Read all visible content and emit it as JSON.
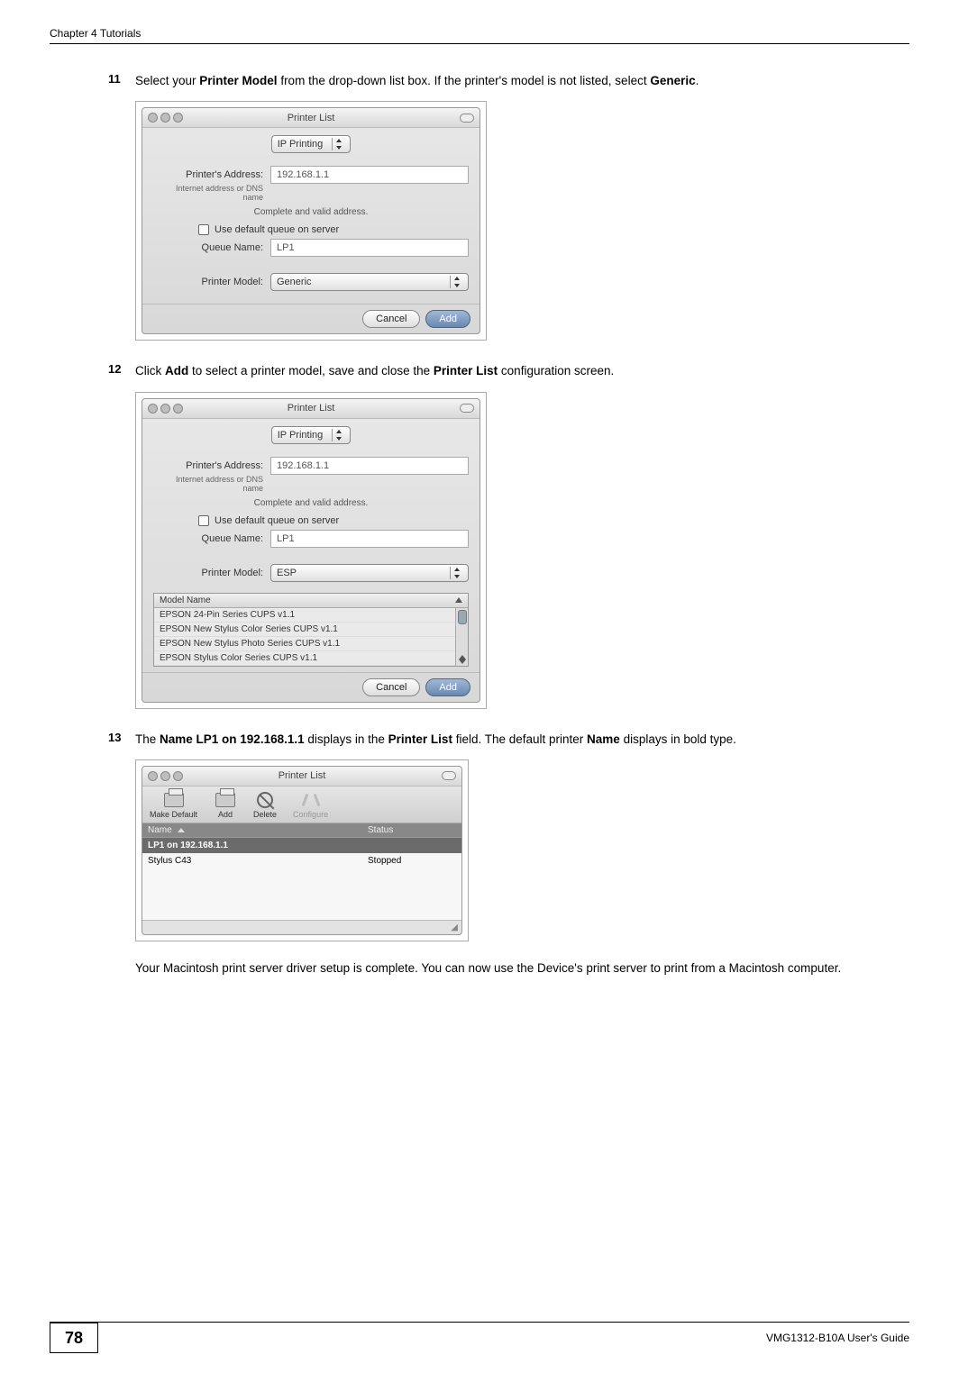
{
  "header": {
    "left": "Chapter 4 Tutorials"
  },
  "steps": {
    "s11": {
      "num": "11",
      "pre": "Select your ",
      "bold1": "Printer Model",
      "mid": " from the drop-down list box. If the printer's model is not listed, select ",
      "bold2": "Generic",
      "post": "."
    },
    "s12": {
      "num": "12",
      "pre": "Click ",
      "bold1": "Add",
      "mid": " to select a printer model, save and close the ",
      "bold2": "Printer List",
      "post": " configuration screen."
    },
    "s13": {
      "num": "13",
      "pre": "The ",
      "bold1": "Name LP1 on 192.168.1.1",
      "mid": " displays in the ",
      "bold2": "Printer List",
      "mid2": " field. The default printer ",
      "bold3": "Name",
      "post": " displays in bold type."
    }
  },
  "dialog1": {
    "title": "Printer List",
    "connection": "IP Printing",
    "labels": {
      "address": "Printer's Address:",
      "address_sub": "Internet address or DNS name",
      "status": "Complete and valid address.",
      "use_default": "Use default queue on server",
      "queue": "Queue Name:",
      "model": "Printer Model:"
    },
    "values": {
      "address": "192.168.1.1",
      "queue": "LP1",
      "model": "Generic"
    },
    "buttons": {
      "cancel": "Cancel",
      "add": "Add"
    }
  },
  "dialog2": {
    "title": "Printer List",
    "connection": "IP Printing",
    "labels": {
      "address": "Printer's Address:",
      "address_sub": "Internet address or DNS name",
      "status": "Complete and valid address.",
      "use_default": "Use default queue on server",
      "queue": "Queue Name:",
      "model": "Printer Model:",
      "model_header": "Model Name"
    },
    "values": {
      "address": "192.168.1.1",
      "queue": "LP1",
      "model": "ESP"
    },
    "models": {
      "r0": "EPSON 24-Pin Series CUPS v1.1",
      "r1": "EPSON New Stylus Color Series CUPS v1.1",
      "r2": "EPSON New Stylus Photo Series CUPS v1.1",
      "r3": "EPSON Stylus Color Series CUPS v1.1"
    },
    "buttons": {
      "cancel": "Cancel",
      "add": "Add"
    }
  },
  "dialog3": {
    "title": "Printer List",
    "toolbar": {
      "make_default": "Make Default",
      "add": "Add",
      "delete": "Delete",
      "configure": "Configure"
    },
    "columns": {
      "name": "Name",
      "status": "Status"
    },
    "rows": {
      "r0": {
        "name": "LP1 on 192.168.1.1",
        "status": ""
      },
      "r1": {
        "name": "Stylus C43",
        "status": "Stopped"
      }
    }
  },
  "closing": "Your Macintosh print server driver setup is complete. You can now use the Device's print server to print from a Macintosh computer.",
  "footer": {
    "page": "78",
    "guide": "VMG1312-B10A User's Guide"
  }
}
